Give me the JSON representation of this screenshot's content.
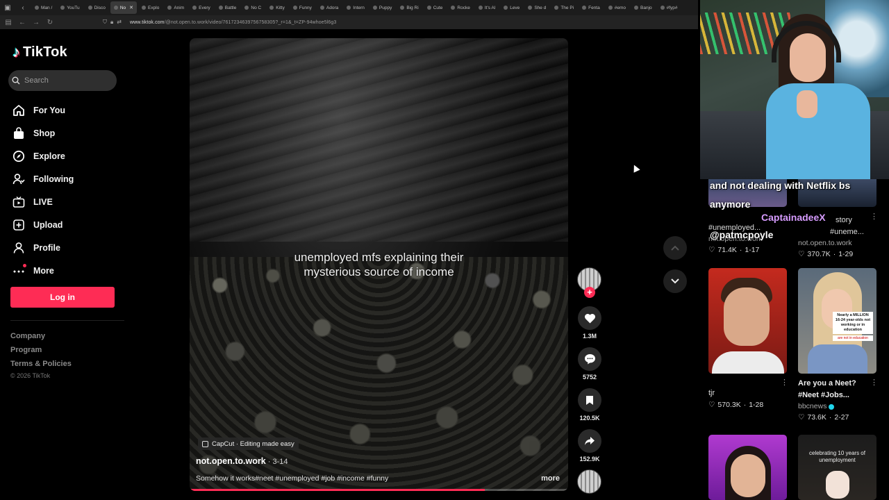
{
  "browser": {
    "tabs": [
      "Man /",
      "YouTu",
      "Disco",
      "No",
      "Explo",
      "Anim",
      "Every",
      "Battle",
      "No C",
      "Kitty",
      "Funny",
      "Adora",
      "Intern",
      "Puppy",
      "Big Ri",
      "Cute",
      "Rocke",
      "It's Al",
      "Leve",
      "She d",
      "The Pi",
      "Fenta",
      "#emo",
      "Banjo",
      "#fyp#"
    ],
    "active_tab_index": 3,
    "url_host": "www.tiktok.com",
    "url_path": "/@not.open.to.work/video/7617234639756758305?_r=1&_t=ZP-94whoe5l6g3"
  },
  "sidebar": {
    "logo_text": "TikTok",
    "search_placeholder": "Search",
    "nav": [
      {
        "label": "For You",
        "icon": "home-icon"
      },
      {
        "label": "Shop",
        "icon": "shopping-bag-icon"
      },
      {
        "label": "Explore",
        "icon": "compass-icon"
      },
      {
        "label": "Following",
        "icon": "user-follow-icon"
      },
      {
        "label": "LIVE",
        "icon": "live-tv-icon"
      },
      {
        "label": "Upload",
        "icon": "plus-square-icon"
      },
      {
        "label": "Profile",
        "icon": "person-icon"
      },
      {
        "label": "More",
        "icon": "more-dots-icon"
      }
    ],
    "login_label": "Log in",
    "footer": [
      "Company",
      "Program",
      "Terms & Policies"
    ],
    "copyright": "© 2026 TikTok"
  },
  "video": {
    "caption_line1": "unemployed mfs explaining their",
    "caption_line2": "mysterious source of income",
    "capcut_label": "CapCut · Editing made easy",
    "author": "not.open.to.work",
    "date": " · 3-14",
    "description": "Somehow it works#neet #unemployed #job #income #funny",
    "more_label": "more",
    "progress": 0.78
  },
  "actions": {
    "likes": "1.3M",
    "comments": "5752",
    "saves": "120.5K",
    "shares": "152.9K"
  },
  "overlay": {
    "stream_text": "and not dealing with Netflix bs anymore",
    "streamer_name": "CaptainadeeX",
    "twitch_handle": "@patmcpoyle"
  },
  "recommended": {
    "top_left": {
      "title": "#unemployed...",
      "author": "not.open.to.work",
      "views": "71.4K",
      "date": "1-17"
    },
    "top_right": {
      "title": "story",
      "title2": "#uneme...",
      "author": "not.open.to.work",
      "views": "370.7K",
      "date": "1-29"
    },
    "mid_left": {
      "title": "tjr",
      "views": "570.3K",
      "date": "1-28"
    },
    "mid_right": {
      "title": "Are you a Neet? #Neet #Jobs...",
      "author": "bbcnews",
      "views": "73.6K",
      "date": "2-27",
      "thumb_caption": "Nearly a MILLION 16-24 year-olds not working or in education",
      "thumb_caption2": "are not in education"
    },
    "bottom_right": {
      "thumb_text": "celebrating 10 years of unemployment"
    }
  },
  "colors": {
    "accent": "#fe2c55",
    "background": "#000000",
    "verified": "#20d5ec"
  }
}
